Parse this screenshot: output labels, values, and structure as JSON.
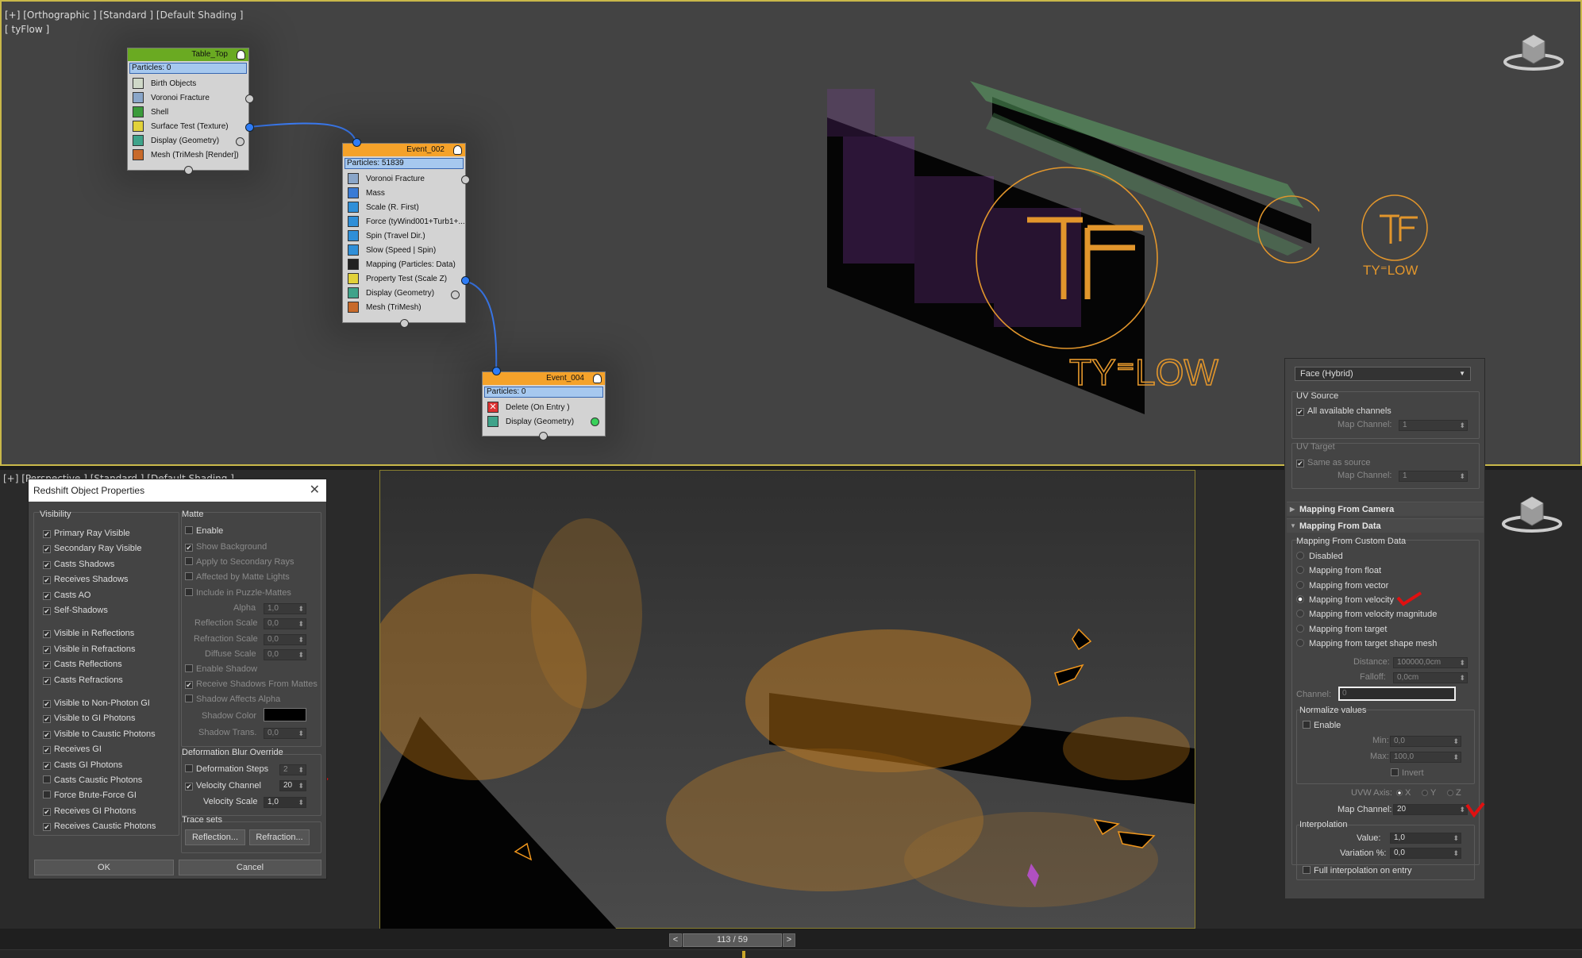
{
  "viewport_top": {
    "label1": "[+] [Orthographic ] [Standard ] [Default Shading ]",
    "label2": "[ tyFlow ]"
  },
  "viewport_bottom": {
    "label": "[+] [Perspective ] [Standard ] [Default Shading ]"
  },
  "nodes": {
    "table_top": {
      "title": "Table_Top",
      "particles": "Particles: 0",
      "ops": [
        "Birth Objects",
        "Voronoi Fracture",
        "Shell",
        "Surface Test (Texture)",
        "Display (Geometry)",
        "Mesh (TriMesh [Render])"
      ]
    },
    "event_002": {
      "title": "Event_002",
      "particles": "Particles: 51839",
      "ops": [
        "Voronoi Fracture",
        "Mass",
        "Scale (R. First)",
        "Force (tyWind001+Turb1+...",
        "Spin (Travel Dir.)",
        "Slow (Speed | Spin)",
        "Mapping (Particles: Data)",
        "Property Test (Scale Z)",
        "Display (Geometry)",
        "Mesh (TriMesh)"
      ]
    },
    "event_004": {
      "title": "Event_004",
      "particles": "Particles: 0",
      "ops": [
        "Delete (On Entry )",
        "Display (Geometry)"
      ]
    }
  },
  "logo": {
    "small_text": "TY⁼LOW",
    "big_text": "TY⁼LOW"
  },
  "mapping_panel": {
    "dropdown": "Face (Hybrid)",
    "uv_source": {
      "label": "UV Source",
      "all_channels": "All available channels",
      "map_channel_label": "Map Channel:",
      "map_channel": "1"
    },
    "uv_target": {
      "label": "UV Target",
      "same_as_source": "Same as source",
      "map_channel_label": "Map Channel:",
      "map_channel": "1"
    },
    "rollout_camera": "Mapping From Camera",
    "rollout_data": "Mapping From Data",
    "custom_data_label": "Mapping From Custom Data",
    "options": [
      "Disabled",
      "Mapping from float",
      "Mapping from vector",
      "Mapping from velocity",
      "Mapping from velocity magnitude",
      "Mapping from target",
      "Mapping from target shape mesh"
    ],
    "selected_option": "Mapping from velocity",
    "distance_label": "Distance:",
    "distance": "100000,0cm",
    "falloff_label": "Falloff:",
    "falloff": "0,0cm",
    "channel_label": "Channel:",
    "channel": "0",
    "normalize": {
      "label": "Normalize values",
      "enable": "Enable",
      "min_label": "Min:",
      "min": "0,0",
      "max_label": "Max:",
      "max": "100,0",
      "invert": "Invert"
    },
    "uvw_axis_label": "UVW Axis:",
    "axes": [
      "X",
      "Y",
      "Z"
    ],
    "map_channel_label": "Map Channel:",
    "map_channel": "20",
    "interpolation": {
      "label": "Interpolation",
      "value_label": "Value:",
      "value": "1,0",
      "variation_label": "Variation %:",
      "variation": "0,0",
      "full_interp": "Full interpolation on entry"
    }
  },
  "rs_dialog": {
    "title": "Redshift Object Properties",
    "visibility_label": "Visibility",
    "visibility": [
      {
        "label": "Primary Ray Visible",
        "checked": true
      },
      {
        "label": "Secondary Ray Visible",
        "checked": true
      },
      {
        "label": "Casts Shadows",
        "checked": true
      },
      {
        "label": "Receives Shadows",
        "checked": true
      },
      {
        "label": "Casts AO",
        "checked": true
      },
      {
        "label": "Self-Shadows",
        "checked": true
      },
      {
        "label": "Visible in Reflections",
        "checked": true
      },
      {
        "label": "Visible in Refractions",
        "checked": true
      },
      {
        "label": "Casts Reflections",
        "checked": true
      },
      {
        "label": "Casts Refractions",
        "checked": true
      },
      {
        "label": "Visible to Non-Photon GI",
        "checked": true
      },
      {
        "label": "Visible to GI Photons",
        "checked": true
      },
      {
        "label": "Visible to Caustic Photons",
        "checked": true
      },
      {
        "label": "Receives GI",
        "checked": true
      },
      {
        "label": "Casts GI Photons",
        "checked": true
      },
      {
        "label": "Casts Caustic Photons",
        "checked": false
      },
      {
        "label": "Force Brute-Force GI",
        "checked": false
      },
      {
        "label": "Receives GI Photons",
        "checked": true
      },
      {
        "label": "Receives Caustic Photons",
        "checked": true
      }
    ],
    "matte_label": "Matte",
    "matte": {
      "enable": "Enable",
      "show_background": "Show Background",
      "apply_secondary": "Apply to Secondary Rays",
      "affected_by_matte": "Affected by Matte Lights",
      "include_puzzle": "Include in Puzzle-Mattes",
      "alpha_label": "Alpha",
      "alpha": "1,0",
      "refl_scale_label": "Reflection Scale",
      "refl_scale": "0,0",
      "refr_scale_label": "Refraction Scale",
      "refr_scale": "0,0",
      "diffuse_label": "Diffuse Scale",
      "diffuse": "0,0",
      "enable_shadow": "Enable Shadow",
      "receive_shadows": "Receive Shadows From Mattes",
      "shadow_alpha": "Shadow Affects Alpha",
      "shadow_color_label": "Shadow Color",
      "shadow_trans_label": "Shadow Trans.",
      "shadow_trans": "0,0"
    },
    "deform_label": "Deformation Blur Override",
    "deform": {
      "steps_label": "Deformation Steps",
      "steps": "2",
      "vel_channel_label": "Velocity Channel",
      "vel_channel": "20",
      "vel_scale_label": "Velocity Scale",
      "vel_scale": "1,0"
    },
    "trace_label": "Trace sets",
    "reflection_btn": "Reflection...",
    "refraction_btn": "Refraction...",
    "ok": "OK",
    "cancel": "Cancel"
  },
  "timeline": {
    "frame": "113 / 59",
    "prev": "<",
    "next": ">"
  },
  "colors": {
    "viewport_border": "#c9b84a",
    "particle_orange": "#f0961c",
    "purple": "#8a3bb0",
    "green": "#5fb06a",
    "node_green": "#6aaa22",
    "node_orange": "#f5a22a"
  }
}
